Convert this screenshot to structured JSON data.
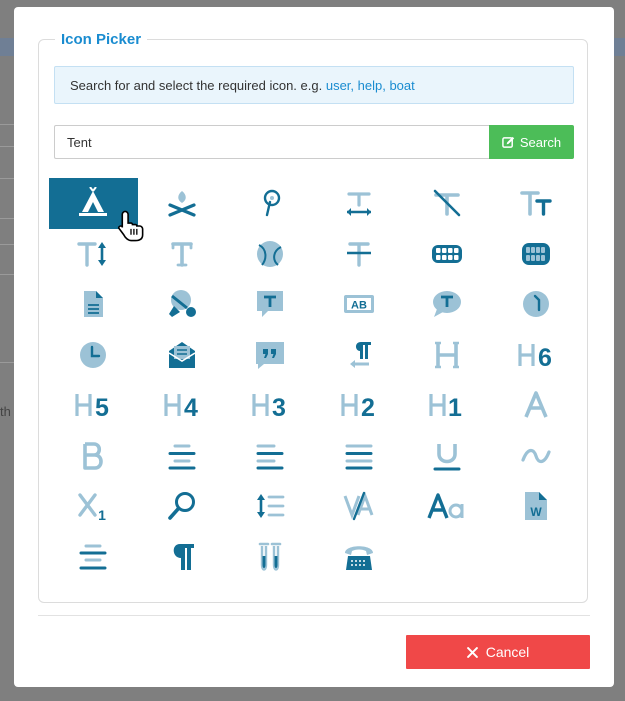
{
  "picker": {
    "title": "Icon Picker",
    "hint_prefix": "Search for and select the required icon. e.g.",
    "hint_examples": "user, help, boat",
    "search_value": "Tent",
    "search_label": "Search",
    "cancel_label": "Cancel"
  },
  "background": {
    "fragment_text": "th"
  },
  "colors": {
    "accent": "#1a8cd0",
    "dark": "#136e94",
    "light": "#9cc2d6",
    "search": "#4cbd58",
    "cancel": "#f04848"
  },
  "icons": [
    "tent-icon",
    "campfire-icon",
    "map-pin-icon",
    "text-width-icon",
    "text-slash-icon",
    "text-size-icon",
    "text-height-icon",
    "text-icon",
    "tennis-ball-icon",
    "strikethrough-icon",
    "teeth-open-icon",
    "teeth-icon",
    "file-alt-icon",
    "table-tennis-icon",
    "comment-alt-text-icon",
    "ab-text-icon",
    "comment-text-icon",
    "clock-icon",
    "clock-nine-icon",
    "envelope-open-text-icon",
    "quote-icon",
    "paragraph-rtl-icon",
    "heading-icon",
    "h6-icon",
    "h5-icon",
    "h4-icon",
    "h3-icon",
    "h2-icon",
    "h1-icon",
    "font-icon",
    "bold-icon",
    "align-center-icon",
    "align-left-icon",
    "align-justify-icon",
    "underline-icon",
    "tilde-icon",
    "subscript-icon",
    "search-icon",
    "line-height-icon",
    "kerning-icon",
    "font-case-icon",
    "file-word-icon",
    "align-center-alt-icon",
    "paragraph-icon",
    "test-tubes-icon",
    "phone-rotary-icon"
  ]
}
